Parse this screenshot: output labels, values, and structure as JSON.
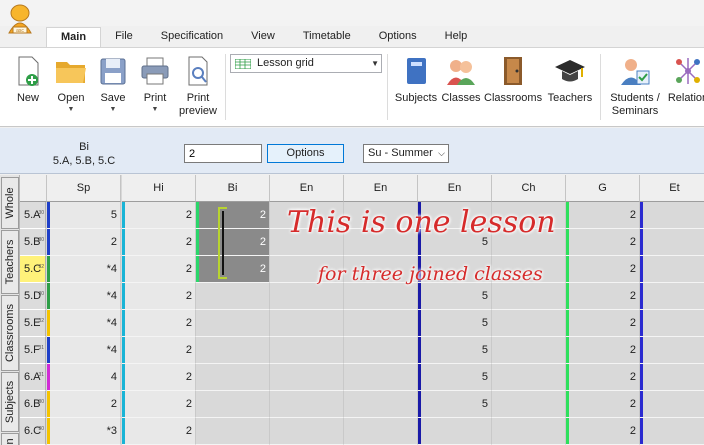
{
  "tabs": [
    "Main",
    "File",
    "Specification",
    "View",
    "Timetable",
    "Options",
    "Help"
  ],
  "ribbon": {
    "new": "New",
    "open": "Open",
    "save": "Save",
    "print": "Print",
    "print_preview_1": "Print",
    "print_preview_2": "preview",
    "view_select": "Lesson grid",
    "subjects": "Subjects",
    "classes": "Classes",
    "classrooms": "Classrooms",
    "teachers": "Teachers",
    "students_1": "Students /",
    "students_2": "Seminars",
    "relations": "Relation"
  },
  "filter": {
    "subject": "Bi",
    "classes": "5.A, 5.B, 5.C",
    "count_value": "2",
    "options_label": "Options",
    "term": "Su - Summer"
  },
  "side_tabs": [
    "Whole",
    "Teachers",
    "Classrooms",
    "Subjects",
    "In"
  ],
  "columns": [
    "Sp",
    "Hi",
    "Bi",
    "En",
    "En",
    "En",
    "Ch",
    "G",
    "Et"
  ],
  "rows": [
    {
      "label": "5.A",
      "sub": "30",
      "cells": [
        "5",
        "2",
        "2",
        "",
        "",
        "",
        "",
        "2",
        ""
      ]
    },
    {
      "label": "5.B",
      "sub": "30",
      "cells": [
        "2",
        "2",
        "2",
        "",
        "",
        "5",
        "",
        "2",
        ""
      ]
    },
    {
      "label": "5.C",
      "sub": "32",
      "cells": [
        "*4",
        "2",
        "2",
        "",
        "",
        "",
        "",
        "2",
        ""
      ]
    },
    {
      "label": "5.D",
      "sub": "30",
      "cells": [
        "*4",
        "2",
        "",
        "",
        "",
        "5",
        "",
        "2",
        ""
      ]
    },
    {
      "label": "5.E",
      "sub": "32",
      "cells": [
        "*4",
        "2",
        "",
        "",
        "",
        "5",
        "",
        "2",
        ""
      ]
    },
    {
      "label": "5.F",
      "sub": "31",
      "cells": [
        "*4",
        "2",
        "",
        "",
        "",
        "5",
        "",
        "2",
        ""
      ]
    },
    {
      "label": "6.A",
      "sub": "31",
      "cells": [
        "4",
        "2",
        "",
        "",
        "",
        "5",
        "",
        "2",
        ""
      ]
    },
    {
      "label": "6.B",
      "sub": "30",
      "cells": [
        "2",
        "2",
        "",
        "",
        "",
        "5",
        "",
        "2",
        ""
      ]
    },
    {
      "label": "6.C",
      "sub": "30",
      "cells": [
        "*3",
        "2",
        "",
        "",
        "",
        "",
        "",
        "2",
        ""
      ]
    }
  ],
  "annotation": {
    "title": "This is one lesson",
    "subtitle": "for three joined classes"
  }
}
